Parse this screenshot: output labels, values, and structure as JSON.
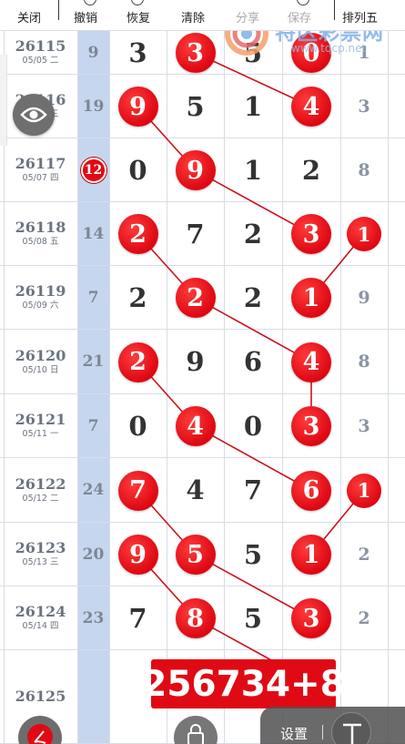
{
  "toolbar": {
    "items": [
      {
        "label": "关闭",
        "name": "close-button"
      },
      {
        "label": "撤销",
        "name": "undo-button"
      },
      {
        "label": "恢复",
        "name": "redo-button"
      },
      {
        "label": "清除",
        "name": "clear-button"
      },
      {
        "label": "分享",
        "name": "share-button"
      },
      {
        "label": "保存",
        "name": "save-button"
      },
      {
        "label": "排列五",
        "name": "lottery-type-button"
      }
    ]
  },
  "watermark": {
    "text": "特区彩票网",
    "url": "www.tqcp.net"
  },
  "rows": [
    {
      "issue": "26115",
      "date": "05/05 二",
      "sum": "9",
      "digits": [
        "3",
        "3",
        "5",
        "0"
      ],
      "last": "1",
      "hot": [
        1,
        3
      ]
    },
    {
      "issue": "26116",
      "date": "05/06 三",
      "sum": "19",
      "digits": [
        "9",
        "5",
        "1",
        "4"
      ],
      "last": "3",
      "hot": [
        0,
        3
      ]
    },
    {
      "issue": "26117",
      "date": "05/07 四",
      "sum": "12",
      "digits": [
        "0",
        "9",
        "1",
        "2"
      ],
      "last": "8",
      "hot": [
        1
      ],
      "sum_hot": true
    },
    {
      "issue": "26118",
      "date": "05/08 五",
      "sum": "14",
      "digits": [
        "2",
        "7",
        "2",
        "3"
      ],
      "last": "1",
      "hot": [
        0,
        3
      ],
      "last_hot": true
    },
    {
      "issue": "26119",
      "date": "05/09 六",
      "sum": "7",
      "digits": [
        "2",
        "2",
        "2",
        "1"
      ],
      "last": "9",
      "hot": [
        1,
        3
      ]
    },
    {
      "issue": "26120",
      "date": "05/10 日",
      "sum": "21",
      "digits": [
        "2",
        "9",
        "6",
        "4"
      ],
      "last": "8",
      "hot": [
        0,
        3
      ]
    },
    {
      "issue": "26121",
      "date": "05/11 一",
      "sum": "7",
      "digits": [
        "0",
        "4",
        "0",
        "3"
      ],
      "last": "3",
      "hot": [
        1,
        3
      ]
    },
    {
      "issue": "26122",
      "date": "05/12 二",
      "sum": "24",
      "digits": [
        "7",
        "4",
        "7",
        "6"
      ],
      "last": "1",
      "hot": [
        0,
        3
      ],
      "last_hot": true
    },
    {
      "issue": "26123",
      "date": "05/13 三",
      "sum": "20",
      "digits": [
        "9",
        "5",
        "5",
        "1"
      ],
      "last": "2",
      "hot": [
        0,
        1,
        3
      ]
    },
    {
      "issue": "26124",
      "date": "05/14 四",
      "sum": "23",
      "digits": [
        "7",
        "8",
        "5",
        "3"
      ],
      "last": "2",
      "hot": [
        1,
        3
      ]
    },
    {
      "issue": "26125",
      "date": "",
      "sum": "",
      "digits": [
        "",
        "",
        "",
        ""
      ],
      "last": "",
      "hot": []
    }
  ],
  "result": "256734+8",
  "bottom": {
    "settings_label": "设置"
  },
  "colors": {
    "ball": "#e00a14",
    "sum_column": "#c6d6ee",
    "line": "#d0101a"
  }
}
